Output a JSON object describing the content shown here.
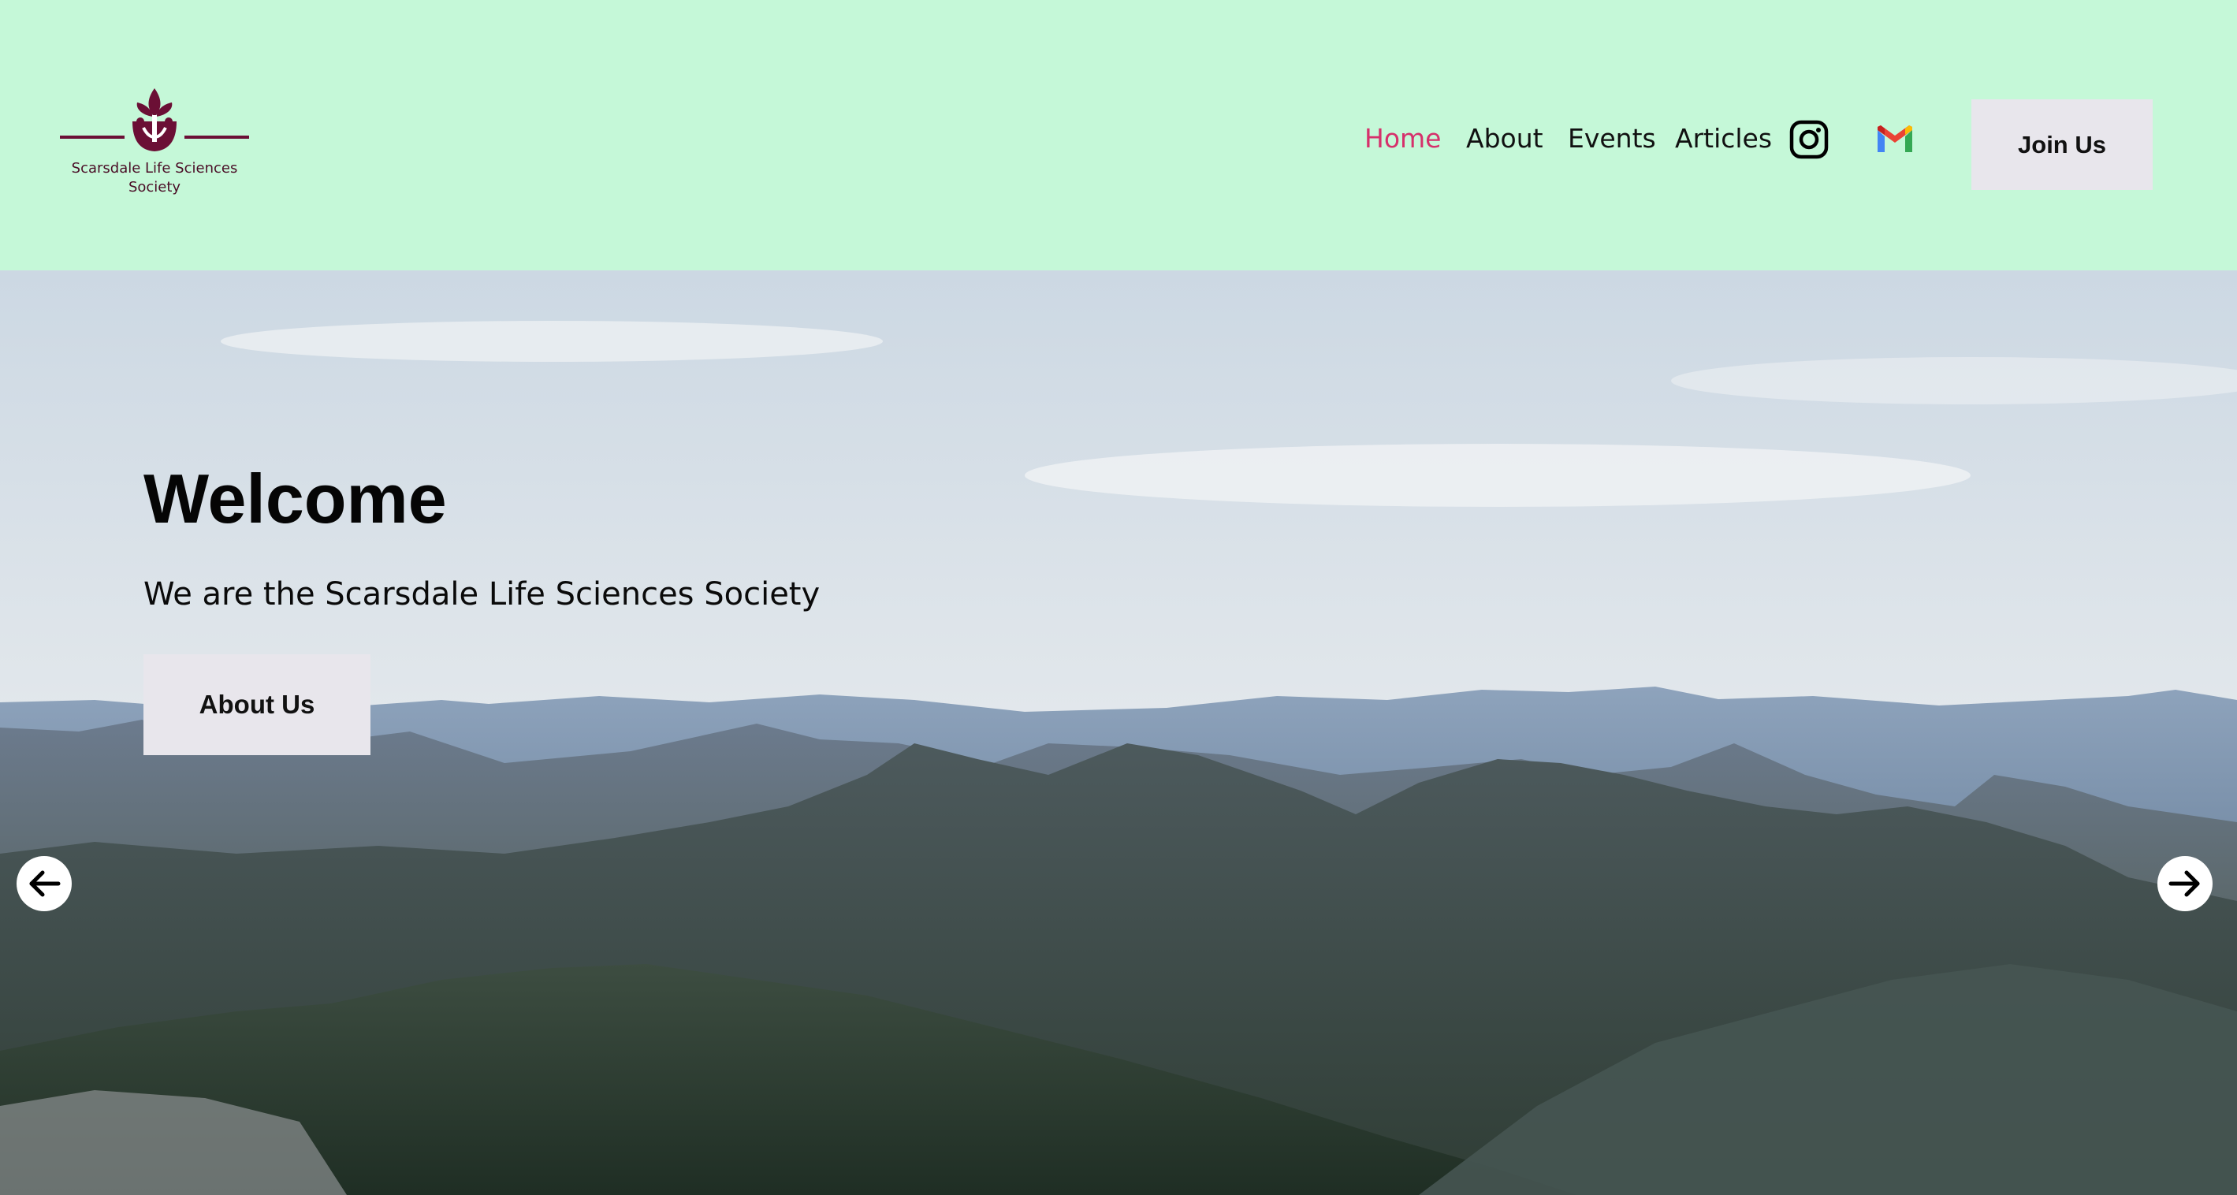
{
  "header": {
    "logo_text": "Scarsdale Life Sciences Society",
    "logo_icon": "tree-hands-icon",
    "background_color": "#c5f8d8",
    "brand_color": "#6b0f35"
  },
  "nav": {
    "items": [
      {
        "label": "Home",
        "active": true
      },
      {
        "label": "About",
        "active": false
      },
      {
        "label": "Events",
        "active": false
      },
      {
        "label": "Articles",
        "active": false
      }
    ],
    "active_color": "#d6306b",
    "social": [
      {
        "icon": "instagram-icon"
      },
      {
        "icon": "gmail-icon"
      }
    ],
    "join_label": "Join Us"
  },
  "hero": {
    "title": "Welcome",
    "subtitle": "We are the Scarsdale Life Sciences Society",
    "button_label": "About Us",
    "image": "mountain-landscape",
    "prev_icon": "arrow-left-icon",
    "next_icon": "arrow-right-icon"
  }
}
